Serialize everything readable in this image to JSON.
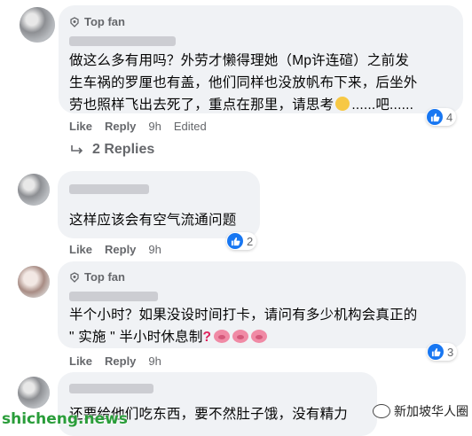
{
  "comments": [
    {
      "badge": "Top fan",
      "text_line1": "做这么多有用吗？外劳才懒得理她（Mp许连碹）之前发",
      "text_line2": "生车祸的罗厘也有盖，他们同样也没放帆布下来，后坐外",
      "text_line3": "劳也照样飞出去死了，重点在那里，请思考",
      "text_suffix": "......吧......",
      "like": "Like",
      "reply": "Reply",
      "time": "9h",
      "edited": "Edited",
      "reactions": "4"
    },
    {
      "text_line1": "这样应该会有空气流通问题",
      "like": "Like",
      "reply": "Reply",
      "time": "9h",
      "reactions": "2"
    },
    {
      "badge": "Top fan",
      "text_line1": "半个小时？如果没设时间打卡，请问有多少机构会真正的",
      "text_line2": "\" 实施 \" 半小时休息制",
      "like": "Like",
      "reply": "Reply",
      "time": "9h",
      "reactions": "3"
    },
    {
      "text_line1": "还要给他们吃东西，要不然肚子饿，没有精力"
    }
  ],
  "replies_toggle": "2 Replies",
  "watermark_left": "shicheng.news",
  "watermark_right": "新加坡华人圈",
  "colors": {
    "like_blue": "#1877f2",
    "bubble": "#f0f2f5",
    "meta": "#65676b"
  },
  "icons": [
    "top-fan-badge-icon",
    "thinking-face-emoji",
    "question-mark-emoji",
    "pig-nose-emoji",
    "reply-arrow-icon",
    "like-thumb-icon"
  ]
}
